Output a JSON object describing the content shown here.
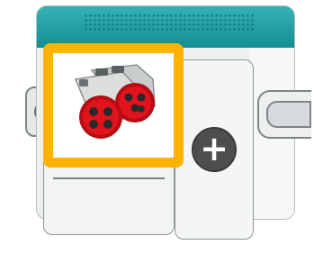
{
  "block": {
    "header_color": "#1e9ea2",
    "selection_color": "#ffb300"
  },
  "motor": {
    "icon": "large-motor-pair-icon"
  },
  "add_button": {
    "label": "+",
    "icon": "plus-icon"
  }
}
